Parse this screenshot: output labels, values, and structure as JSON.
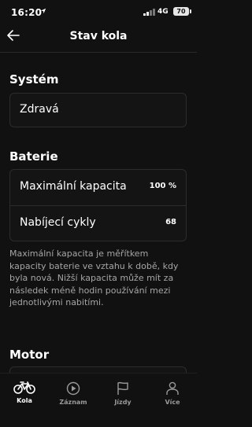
{
  "status_bar": {
    "time": "16:20",
    "network": "4G",
    "battery": "70"
  },
  "header": {
    "title": "Stav kola"
  },
  "system": {
    "heading": "Systém",
    "status": "Zdravá"
  },
  "battery": {
    "heading": "Baterie",
    "rows": [
      {
        "label": "Maximální kapacita",
        "value": "100 %"
      },
      {
        "label": "Nabíjecí cykly",
        "value": "68"
      }
    ],
    "note": "Maximální kapacita je měřítkem kapacity baterie ve vztahu k době, kdy byla nová. Nižší kapacita může mít za následek méně hodin používání mezi jednotlivými nabitími."
  },
  "motor": {
    "heading": "Motor"
  },
  "tabs": [
    {
      "label": "Kola",
      "icon": "bike-icon",
      "active": true
    },
    {
      "label": "Záznam",
      "icon": "play-icon",
      "active": false
    },
    {
      "label": "Jízdy",
      "icon": "flag-icon",
      "active": false
    },
    {
      "label": "Více",
      "icon": "person-icon",
      "active": false
    }
  ]
}
